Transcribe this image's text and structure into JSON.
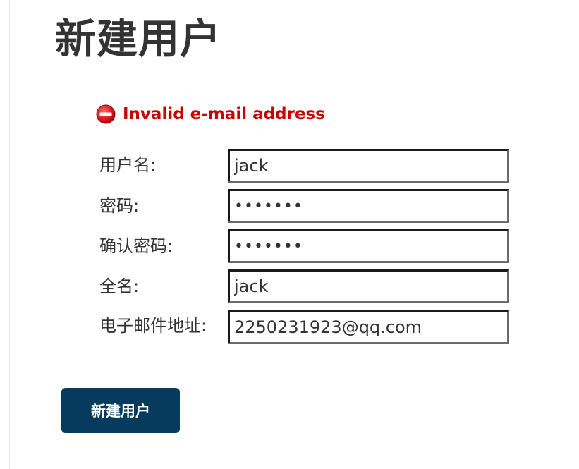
{
  "page": {
    "title": "新建用户"
  },
  "error": {
    "icon": "no-entry-icon",
    "message": "Invalid e-mail address",
    "color": "#cc0000"
  },
  "form": {
    "fields": [
      {
        "label": "用户名:",
        "type": "text",
        "value": "jack"
      },
      {
        "label": "密码:",
        "type": "password",
        "value": "•••••••"
      },
      {
        "label": "确认密码:",
        "type": "password",
        "value": "•••••••"
      },
      {
        "label": "全名:",
        "type": "text",
        "value": "jack"
      },
      {
        "label": "电子邮件地址:",
        "type": "text",
        "value": "2250231923@qq.com"
      }
    ],
    "submit_label": "新建用户",
    "submit_color": "#063b5e"
  }
}
